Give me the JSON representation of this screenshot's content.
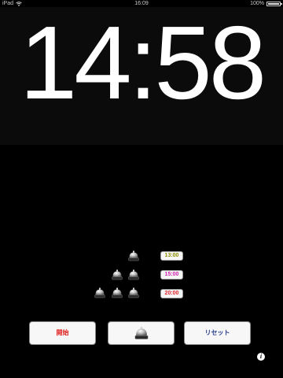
{
  "statusbar": {
    "device": "iPad",
    "time": "16:09",
    "battery": "100%"
  },
  "clock": {
    "display": "14:58"
  },
  "bells": {
    "rows": [
      1,
      2,
      3
    ]
  },
  "presets": [
    {
      "label": "13:00",
      "color": "#8f8f00"
    },
    {
      "label": "15:00",
      "color": "#d21fb4"
    },
    {
      "label": "20:00",
      "color": "#e0262c"
    }
  ],
  "controls": {
    "start_label": "開始",
    "reset_label": "リセット"
  },
  "colors": {
    "start_text": "#e02020",
    "reset_text": "#2a3e8c",
    "background": "#000000"
  },
  "icons": {
    "info": "i"
  }
}
